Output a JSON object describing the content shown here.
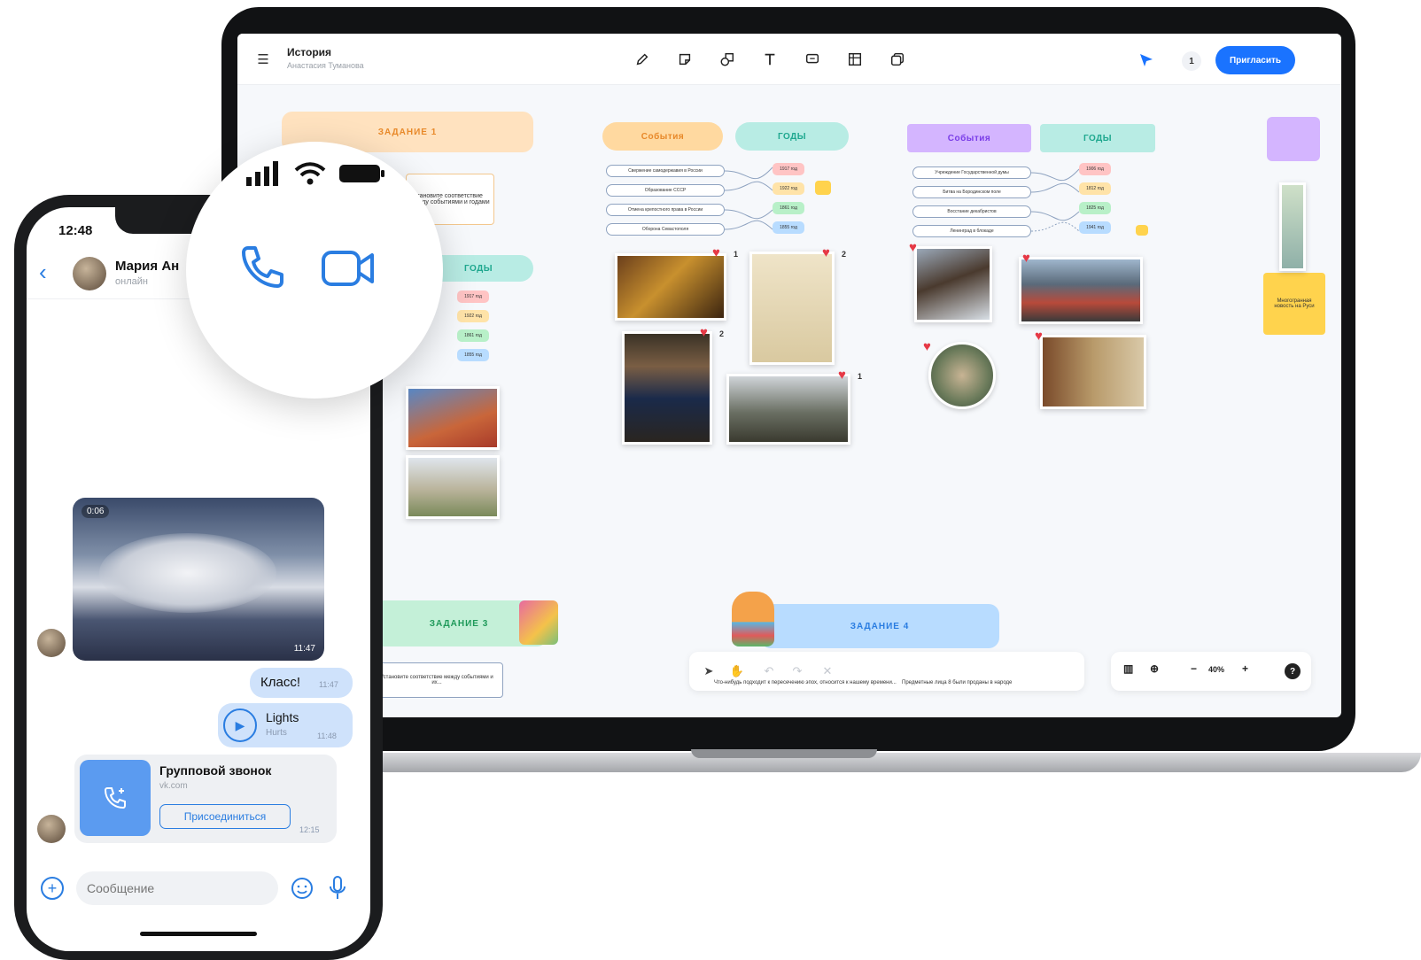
{
  "colors": {
    "accent": "#1a73ff",
    "phone_accent": "#2a7de1",
    "heart": "#e63946",
    "orange_pill": "#ffd9a0",
    "teal_pill": "#b8ece4",
    "purple_pill": "#d4b5ff",
    "green_banner": "#c4f0d8",
    "blue_banner": "#b8dcff"
  },
  "whiteboard": {
    "title": "История",
    "author": "Анастасия Туманова",
    "tools": [
      "pencil-icon",
      "sticky-note-icon",
      "shapes-icon",
      "text-icon",
      "comment-icon",
      "table-icon",
      "frames-icon"
    ],
    "online_count": "1",
    "invite_label": "Пригласить",
    "task1": "ЗАДАНИЕ 1",
    "task1_note": "Установите соответствие между событиями и годами",
    "task3": "ЗАДАНИЕ 3",
    "task3_note": "Установите соответствие между событиями и их...",
    "task4": "ЗАДАНИЕ 4",
    "events_label": "События",
    "years_label": "ГОДЫ",
    "events_left": [
      "Свержение самодержавия в России",
      "Образование СССР",
      "Отмена крепостного права в России",
      "Оборона Севастополя"
    ],
    "events_right": [
      "Учреждение Государственной думы",
      "Битва на Бородинском поле",
      "Восстание декабристов",
      "Ленинград в блокаде"
    ],
    "years_left": [
      "1917 год",
      "1922 год",
      "1861 год",
      "1855 год"
    ],
    "years_right": [
      "1906 год",
      "1812 год",
      "1825 год",
      "1941 год"
    ],
    "likes": [
      "1",
      "2",
      "2",
      "1"
    ],
    "bottom_caption1": "Что-нибудь подходит к пересечению эпох, относится к нашему времени...",
    "bottom_caption2": "Предметные лица 8 были проданы в народе",
    "side_note": "Многогранная новость на Руси",
    "zoom": "40%"
  },
  "phone": {
    "time": "12:48",
    "contact_name": "Мария Ан",
    "contact_status": "онлайн",
    "video_duration": "0:06",
    "video_time": "11:47",
    "msg1_text": "Класс!",
    "msg1_time": "11:47",
    "audio_title": "Lights",
    "audio_artist": "Hurts",
    "audio_time": "11:48",
    "call_title": "Групповой звонок",
    "call_sub": "vk.com",
    "join_label": "Присоединиться",
    "call_time": "12:15",
    "composer_placeholder": "Сообщение"
  }
}
